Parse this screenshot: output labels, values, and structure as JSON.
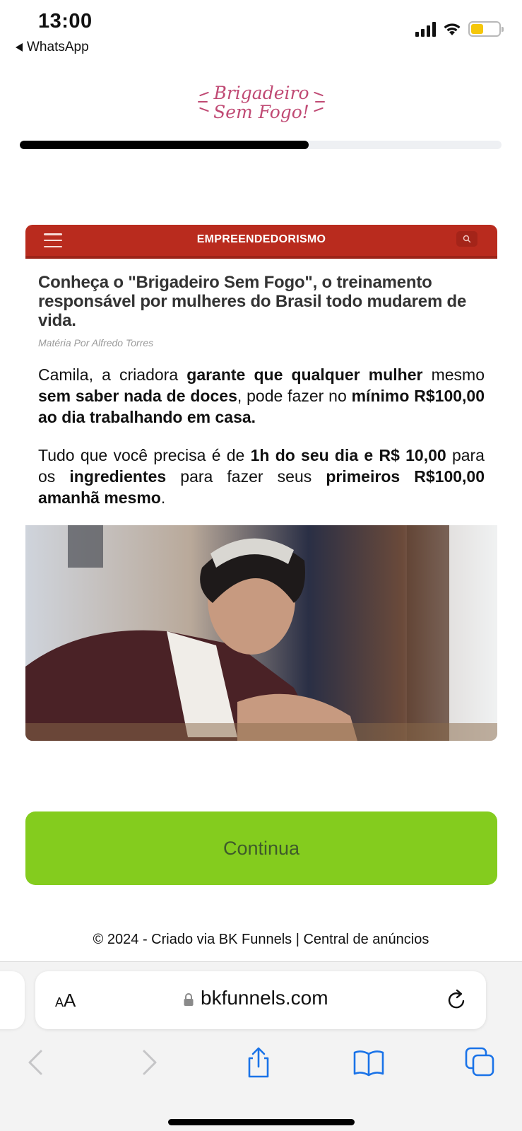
{
  "status_bar": {
    "time": "13:00",
    "back_app": "WhatsApp",
    "battery_level": 0.45,
    "battery_color": "#f5c70b"
  },
  "logo": {
    "line1": "Brigadeiro",
    "line2": "Sem Fogo!",
    "color": "#c04a74"
  },
  "progress": {
    "value": 0.6
  },
  "article": {
    "section_title": "EMPREENDEDORISMO",
    "header_color": "#b92b1e",
    "headline": "Conheça o \"Brigadeiro Sem Fogo\", o treinamento responsável por mulheres do Brasil todo mudarem de vida.",
    "byline": "Matéria Por Alfredo Torres",
    "para1": {
      "t1": "Camila, a criadora ",
      "b1": "garante que qualquer mulher",
      "t2": " mesmo ",
      "b2": "sem saber nada de doces",
      "t3": ", pode fazer no ",
      "b3": "mínimo R$100,00 ao dia trabalhando em casa."
    },
    "para2": {
      "t1": "Tudo que você precisa é de ",
      "b1": "1h do seu dia e R$ 10,00",
      "t2": " para os ",
      "b2": "ingredientes",
      "t3": " para fazer seus ",
      "b3": "primeiros R$100,00 amanhã mesmo",
      "t4": "."
    }
  },
  "cta": {
    "label": "Continua",
    "color": "#84cc1e"
  },
  "footer": {
    "text": "© 2024 - Criado via BK Funnels | Central de anúncios"
  },
  "browser": {
    "aa_label_small": "A",
    "aa_label_large": "A",
    "url": "bkfunnels.com",
    "icons": [
      "back-icon",
      "forward-icon",
      "share-icon",
      "bookmarks-icon",
      "tabs-icon",
      "reload-icon",
      "lock-icon"
    ]
  }
}
